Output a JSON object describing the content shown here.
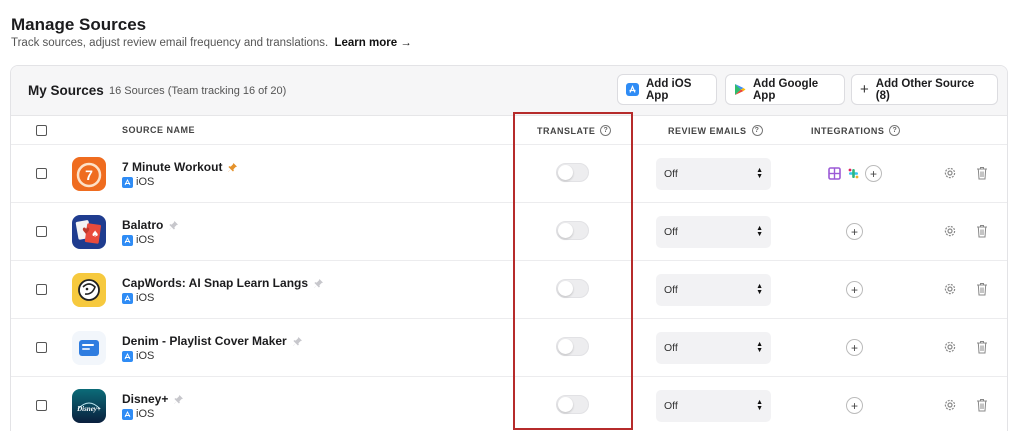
{
  "page": {
    "title": "Manage Sources",
    "subtitle": "Track sources, adjust review email frequency and translations.",
    "learn_more": "Learn more →"
  },
  "sources_card": {
    "title": "My Sources",
    "count": "16 Sources (Team tracking 16 of 20)",
    "buttons": {
      "add_ios": "Add iOS App",
      "add_google": "Add Google App",
      "add_other": "Add Other Source (8)"
    }
  },
  "columns": {
    "source_name": "SOURCE NAME",
    "translate": "TRANSLATE",
    "review_emails": "REVIEW EMAILS",
    "integrations": "INTEGRATIONS"
  },
  "rows": [
    {
      "name": "7 Minute Workout",
      "platform": "iOS",
      "pinned": true,
      "icon": "workout-app-icon",
      "translate": false,
      "review_emails": "Off",
      "integrations": [
        "layout-integration-icon",
        "slack-icon"
      ]
    },
    {
      "name": "Balatro",
      "platform": "iOS",
      "pinned": false,
      "icon": "balatro-app-icon",
      "translate": false,
      "review_emails": "Off",
      "integrations": []
    },
    {
      "name": "CapWords: AI Snap Learn Langs",
      "platform": "iOS",
      "pinned": false,
      "icon": "capwords-app-icon",
      "translate": false,
      "review_emails": "Off",
      "integrations": []
    },
    {
      "name": "Denim - Playlist Cover Maker",
      "platform": "iOS",
      "pinned": false,
      "icon": "denim-app-icon",
      "translate": false,
      "review_emails": "Off",
      "integrations": []
    },
    {
      "name": "Disney+",
      "platform": "iOS",
      "pinned": false,
      "icon": "disney-plus-app-icon",
      "translate": false,
      "review_emails": "Off",
      "integrations": []
    }
  ],
  "colors": {
    "highlight_border": "#b62b2b",
    "pin_active": "#e5922b",
    "pin_inactive": "#c7c7cc",
    "ios_badge": "#2f8cf5"
  }
}
